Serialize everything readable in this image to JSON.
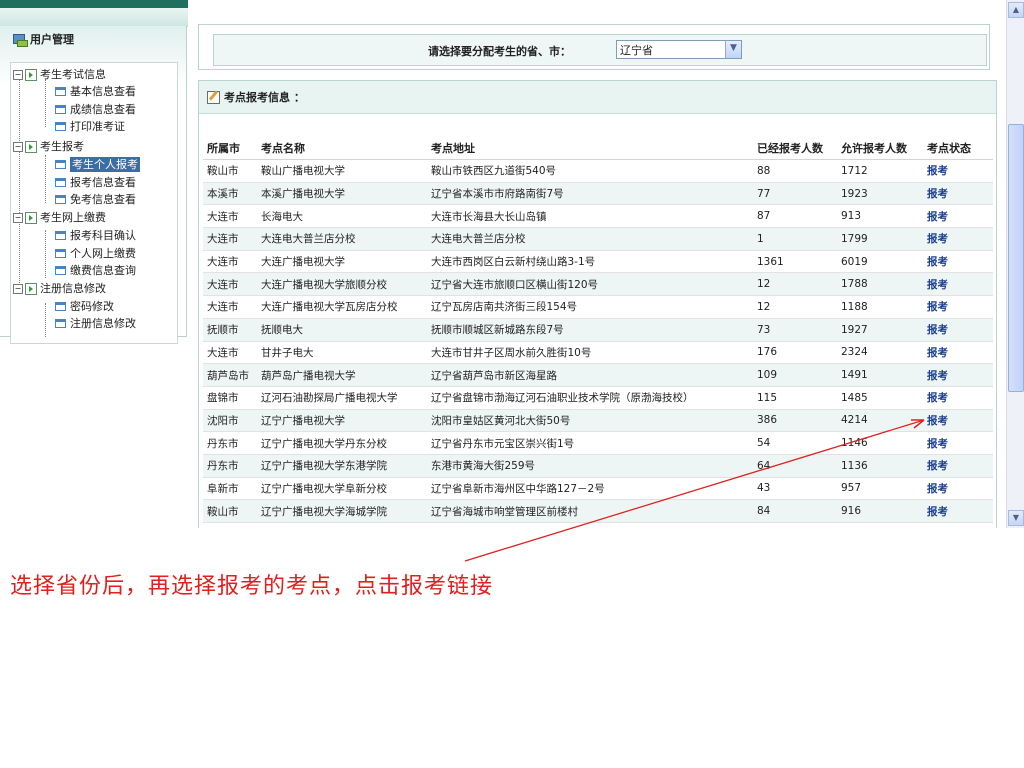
{
  "sidebar": {
    "title": "用户管理",
    "tree": [
      {
        "label": "考生考试信息",
        "children": [
          "基本信息查看",
          "成绩信息查看",
          "打印准考证"
        ]
      },
      {
        "label": "考生报考",
        "children": [
          "考生个人报考",
          "报考信息查看",
          "免考信息查看"
        ]
      },
      {
        "label": "考生网上缴费",
        "children": [
          "报考科目确认",
          "个人网上缴费",
          "缴费信息查询"
        ]
      },
      {
        "label": "注册信息修改",
        "children": [
          "密码修改",
          "注册信息修改"
        ]
      }
    ],
    "selected": "考生个人报考"
  },
  "province_select": {
    "label": "请选择要分配考生的省、市：",
    "value": "辽宁省"
  },
  "site_info": {
    "title": "考点报考信息 ：",
    "columns": [
      "所属市",
      "考点名称",
      "考点地址",
      "已经报考人数",
      "允许报考人数",
      "考点状态"
    ],
    "rows": [
      [
        "鞍山市",
        "鞍山广播电视大学",
        "鞍山市铁西区九道街540号",
        "88",
        "1712",
        "报考"
      ],
      [
        "本溪市",
        "本溪广播电视大学",
        "辽宁省本溪市市府路南街7号",
        "77",
        "1923",
        "报考"
      ],
      [
        "大连市",
        "长海电大",
        "大连市长海县大长山岛镇",
        "87",
        "913",
        "报考"
      ],
      [
        "大连市",
        "大连电大普兰店分校",
        "大连电大普兰店分校",
        "1",
        "1799",
        "报考"
      ],
      [
        "大连市",
        "大连广播电视大学",
        "大连市西岗区白云新村绕山路3-1号",
        "1361",
        "6019",
        "报考"
      ],
      [
        "大连市",
        "大连广播电视大学旅顺分校",
        "辽宁省大连市旅顺口区横山街120号",
        "12",
        "1788",
        "报考"
      ],
      [
        "大连市",
        "大连广播电视大学瓦房店分校",
        "辽宁瓦房店南共济街三段154号",
        "12",
        "1188",
        "报考"
      ],
      [
        "抚顺市",
        "抚顺电大",
        "抚顺市顺城区新城路东段7号",
        "73",
        "1927",
        "报考"
      ],
      [
        "大连市",
        "甘井子电大",
        "大连市甘井子区周水前久胜街10号",
        "176",
        "2324",
        "报考"
      ],
      [
        "葫芦岛市",
        "葫芦岛广播电视大学",
        "辽宁省葫芦岛市新区海星路",
        "109",
        "1491",
        "报考"
      ],
      [
        "盘锦市",
        "辽河石油勘探局广播电视大学",
        "辽宁省盘锦市渤海辽河石油职业技术学院（原渤海技校）",
        "115",
        "1485",
        "报考"
      ],
      [
        "沈阳市",
        "辽宁广播电视大学",
        "沈阳市皇姑区黄河北大街50号",
        "386",
        "4214",
        "报考"
      ],
      [
        "丹东市",
        "辽宁广播电视大学丹东分校",
        "辽宁省丹东市元宝区崇兴街1号",
        "54",
        "1146",
        "报考"
      ],
      [
        "丹东市",
        "辽宁广播电视大学东港学院",
        "东港市黄海大街259号",
        "64",
        "1136",
        "报考"
      ],
      [
        "阜新市",
        "辽宁广播电视大学阜新分校",
        "辽宁省阜新市海州区中华路127－2号",
        "43",
        "957",
        "报考"
      ],
      [
        "鞍山市",
        "辽宁广播电视大学海城学院",
        "辽宁省海城市响堂管理区前楼村",
        "84",
        "916",
        "报考"
      ]
    ]
  },
  "annotation": {
    "caption": "选择省份后，再选择报考的考点，点击报考链接",
    "color": "#e0201e"
  },
  "icons": {
    "user_manage": "user-manage-icon",
    "tree_folder": "folder-arrow-icon",
    "tree_leaf": "page-icon",
    "section": "edit-icon",
    "dropdown": "chevron-down-icon"
  }
}
